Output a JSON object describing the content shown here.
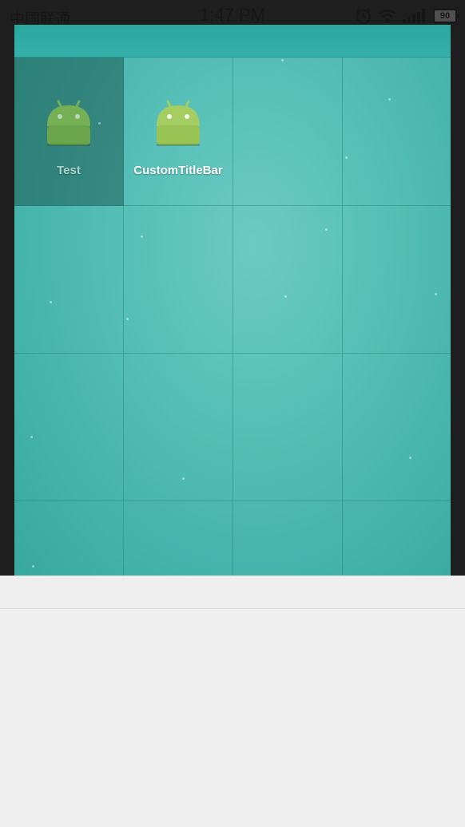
{
  "status_bar": {
    "carrier": "中国联通",
    "time": "1:47 PM",
    "battery": "90",
    "icons": [
      "alarm-icon",
      "wifi-icon",
      "signal-icon",
      "battery-icon"
    ]
  },
  "launcher": {
    "apps": [
      {
        "label": "Test",
        "icon": "android-icon",
        "selected": true
      },
      {
        "label": "CustomTitleBar",
        "icon": "android-icon",
        "selected": false
      }
    ]
  },
  "colors": {
    "accent": "#4fbab1",
    "android_green": "#9bc75a"
  }
}
